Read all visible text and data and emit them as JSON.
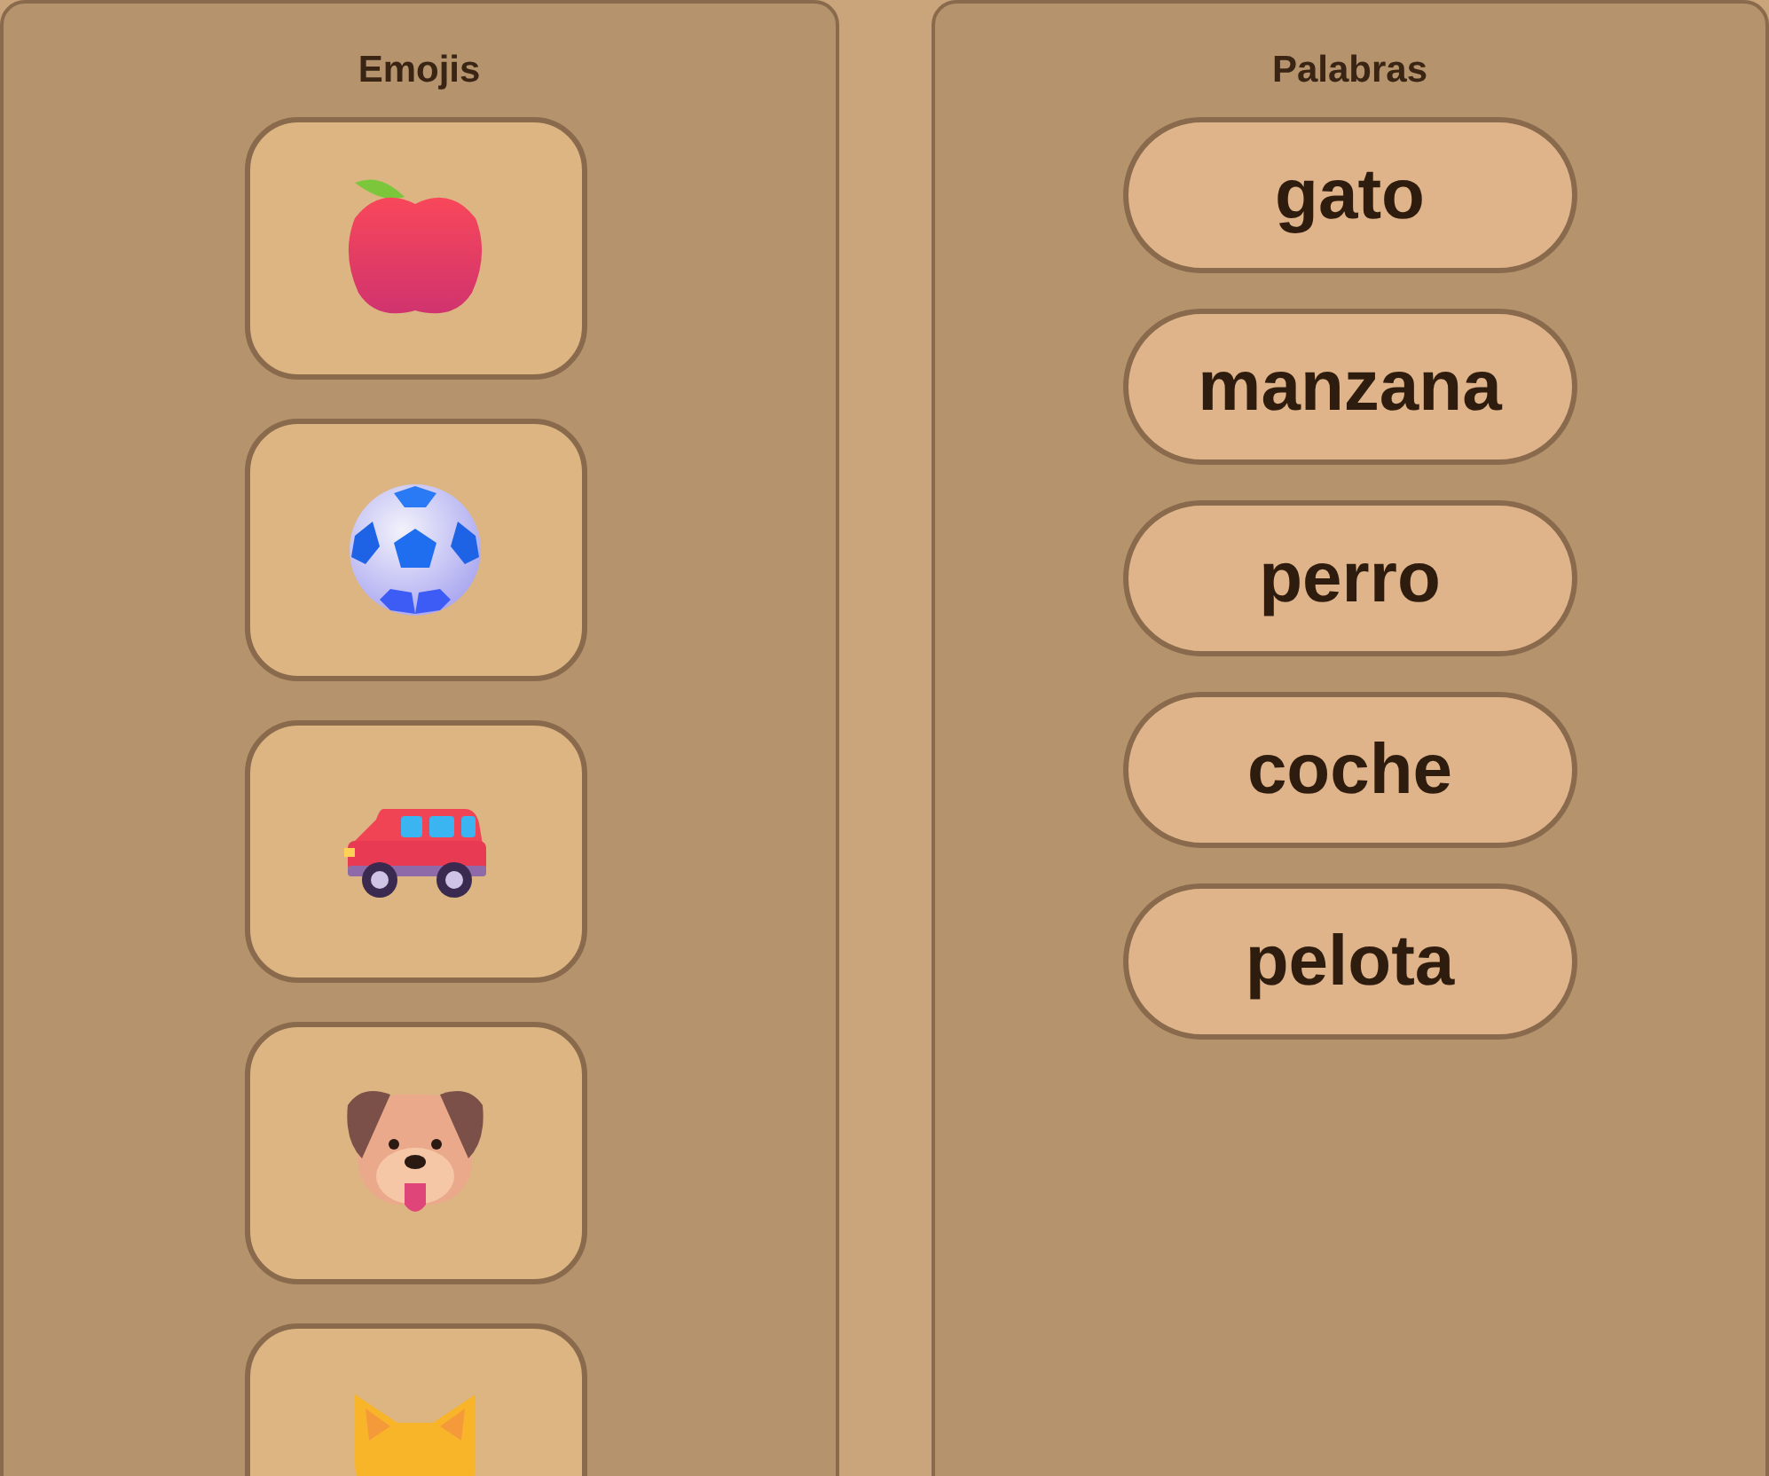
{
  "emoji_panel": {
    "title": "Emojis",
    "cards": [
      {
        "kind": "apple"
      },
      {
        "kind": "ball"
      },
      {
        "kind": "car"
      },
      {
        "kind": "dog"
      },
      {
        "kind": "cat"
      }
    ]
  },
  "word_panel": {
    "title": "Palabras",
    "words": [
      "gato",
      "manzana",
      "perro",
      "coche",
      "pelota"
    ]
  }
}
